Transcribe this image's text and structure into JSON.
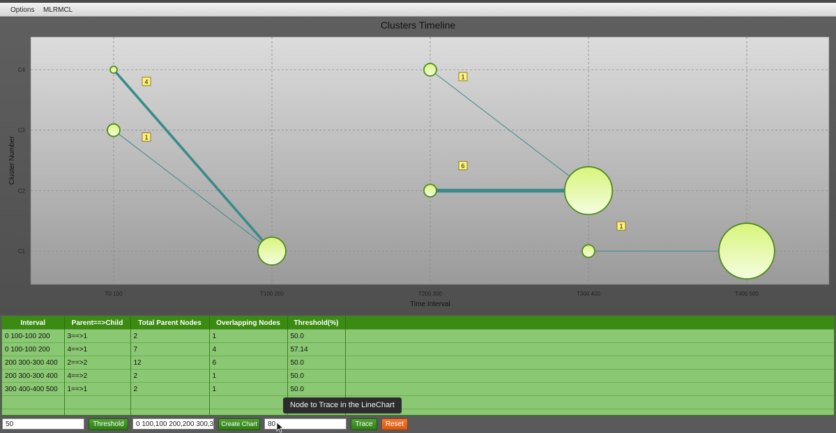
{
  "menu": {
    "items": [
      "Options",
      "MLRMCL"
    ]
  },
  "chart_data": {
    "type": "scatter",
    "title": "Clusters Timeline",
    "xlabel": "Time Interval",
    "ylabel": "Cluster Number",
    "x_categories": [
      "T0 100",
      "T100 200",
      "T200 300",
      "T300 400",
      "T400 500"
    ],
    "y_categories": [
      "C1",
      "C2",
      "C3",
      "C4"
    ],
    "grid": true,
    "nodes": [
      {
        "x": "T0 100",
        "y": "C4",
        "size": 4
      },
      {
        "x": "T0 100",
        "y": "C3",
        "size": 2
      },
      {
        "x": "T100 200",
        "y": "C1",
        "size": 7
      },
      {
        "x": "T200 300",
        "y": "C4",
        "size": 2
      },
      {
        "x": "T200 300",
        "y": "C2",
        "size": 2
      },
      {
        "x": "T300 400",
        "y": "C2",
        "size": 12
      },
      {
        "x": "T300 400",
        "y": "C1",
        "size": 2
      },
      {
        "x": "T400 500",
        "y": "C1",
        "size": 14
      }
    ],
    "edges": [
      {
        "from": [
          "T0 100",
          "C4"
        ],
        "to": [
          "T100 200",
          "C1"
        ],
        "label": "4"
      },
      {
        "from": [
          "T0 100",
          "C3"
        ],
        "to": [
          "T100 200",
          "C1"
        ],
        "label": "1"
      },
      {
        "from": [
          "T200 300",
          "C4"
        ],
        "to": [
          "T300 400",
          "C2"
        ],
        "label": "1"
      },
      {
        "from": [
          "T200 300",
          "C2"
        ],
        "to": [
          "T300 400",
          "C2"
        ],
        "label": "6"
      },
      {
        "from": [
          "T300 400",
          "C1"
        ],
        "to": [
          "T400 500",
          "C1"
        ],
        "label": "1"
      }
    ],
    "colors": {
      "edge": "#3a8a8a",
      "node_fill_top": "#d8f57a",
      "node_fill_bottom": "#f4fde0",
      "node_stroke": "#4f8a1a",
      "badge": "#fff27a"
    }
  },
  "table": {
    "headers": [
      "Interval",
      "Parent==>Child",
      "Total Parent Nodes",
      "Overlapping Nodes",
      "Threshold(%)",
      ""
    ],
    "rows": [
      [
        "0 100-100 200",
        "3==>1",
        "2",
        "1",
        "50.0",
        ""
      ],
      [
        "0 100-100 200",
        "4==>1",
        "7",
        "4",
        "57.14",
        ""
      ],
      [
        "200 300-300 400",
        "2==>2",
        "12",
        "6",
        "50.0",
        ""
      ],
      [
        "200 300-300 400",
        "4==>2",
        "2",
        "1",
        "50.0",
        ""
      ],
      [
        "300 400-400 500",
        "1==>1",
        "2",
        "1",
        "50.0",
        ""
      ],
      [
        "",
        "",
        "",
        "",
        "",
        ""
      ],
      [
        "",
        "",
        "",
        "",
        "",
        ""
      ]
    ]
  },
  "toolbar": {
    "threshold_value": "50",
    "threshold_button": "Threshold",
    "intervals_value": "0 100,100 200,200 300,3",
    "create_chart_button": "Create Chart",
    "trace_value": "80",
    "trace_button": "Trace",
    "reset_button": "Reset"
  },
  "tooltip": "Node to Trace in the LineChart"
}
